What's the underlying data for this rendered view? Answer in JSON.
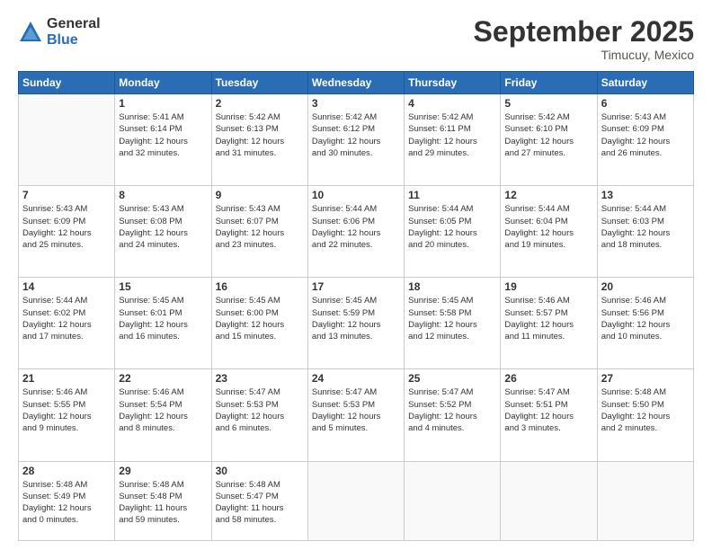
{
  "logo": {
    "general": "General",
    "blue": "Blue"
  },
  "header": {
    "month": "September 2025",
    "location": "Timucuy, Mexico"
  },
  "weekdays": [
    "Sunday",
    "Monday",
    "Tuesday",
    "Wednesday",
    "Thursday",
    "Friday",
    "Saturday"
  ],
  "weeks": [
    [
      {
        "day": "",
        "detail": ""
      },
      {
        "day": "1",
        "detail": "Sunrise: 5:41 AM\nSunset: 6:14 PM\nDaylight: 12 hours\nand 32 minutes."
      },
      {
        "day": "2",
        "detail": "Sunrise: 5:42 AM\nSunset: 6:13 PM\nDaylight: 12 hours\nand 31 minutes."
      },
      {
        "day": "3",
        "detail": "Sunrise: 5:42 AM\nSunset: 6:12 PM\nDaylight: 12 hours\nand 30 minutes."
      },
      {
        "day": "4",
        "detail": "Sunrise: 5:42 AM\nSunset: 6:11 PM\nDaylight: 12 hours\nand 29 minutes."
      },
      {
        "day": "5",
        "detail": "Sunrise: 5:42 AM\nSunset: 6:10 PM\nDaylight: 12 hours\nand 27 minutes."
      },
      {
        "day": "6",
        "detail": "Sunrise: 5:43 AM\nSunset: 6:09 PM\nDaylight: 12 hours\nand 26 minutes."
      }
    ],
    [
      {
        "day": "7",
        "detail": "Sunrise: 5:43 AM\nSunset: 6:09 PM\nDaylight: 12 hours\nand 25 minutes."
      },
      {
        "day": "8",
        "detail": "Sunrise: 5:43 AM\nSunset: 6:08 PM\nDaylight: 12 hours\nand 24 minutes."
      },
      {
        "day": "9",
        "detail": "Sunrise: 5:43 AM\nSunset: 6:07 PM\nDaylight: 12 hours\nand 23 minutes."
      },
      {
        "day": "10",
        "detail": "Sunrise: 5:44 AM\nSunset: 6:06 PM\nDaylight: 12 hours\nand 22 minutes."
      },
      {
        "day": "11",
        "detail": "Sunrise: 5:44 AM\nSunset: 6:05 PM\nDaylight: 12 hours\nand 20 minutes."
      },
      {
        "day": "12",
        "detail": "Sunrise: 5:44 AM\nSunset: 6:04 PM\nDaylight: 12 hours\nand 19 minutes."
      },
      {
        "day": "13",
        "detail": "Sunrise: 5:44 AM\nSunset: 6:03 PM\nDaylight: 12 hours\nand 18 minutes."
      }
    ],
    [
      {
        "day": "14",
        "detail": "Sunrise: 5:44 AM\nSunset: 6:02 PM\nDaylight: 12 hours\nand 17 minutes."
      },
      {
        "day": "15",
        "detail": "Sunrise: 5:45 AM\nSunset: 6:01 PM\nDaylight: 12 hours\nand 16 minutes."
      },
      {
        "day": "16",
        "detail": "Sunrise: 5:45 AM\nSunset: 6:00 PM\nDaylight: 12 hours\nand 15 minutes."
      },
      {
        "day": "17",
        "detail": "Sunrise: 5:45 AM\nSunset: 5:59 PM\nDaylight: 12 hours\nand 13 minutes."
      },
      {
        "day": "18",
        "detail": "Sunrise: 5:45 AM\nSunset: 5:58 PM\nDaylight: 12 hours\nand 12 minutes."
      },
      {
        "day": "19",
        "detail": "Sunrise: 5:46 AM\nSunset: 5:57 PM\nDaylight: 12 hours\nand 11 minutes."
      },
      {
        "day": "20",
        "detail": "Sunrise: 5:46 AM\nSunset: 5:56 PM\nDaylight: 12 hours\nand 10 minutes."
      }
    ],
    [
      {
        "day": "21",
        "detail": "Sunrise: 5:46 AM\nSunset: 5:55 PM\nDaylight: 12 hours\nand 9 minutes."
      },
      {
        "day": "22",
        "detail": "Sunrise: 5:46 AM\nSunset: 5:54 PM\nDaylight: 12 hours\nand 8 minutes."
      },
      {
        "day": "23",
        "detail": "Sunrise: 5:47 AM\nSunset: 5:53 PM\nDaylight: 12 hours\nand 6 minutes."
      },
      {
        "day": "24",
        "detail": "Sunrise: 5:47 AM\nSunset: 5:53 PM\nDaylight: 12 hours\nand 5 minutes."
      },
      {
        "day": "25",
        "detail": "Sunrise: 5:47 AM\nSunset: 5:52 PM\nDaylight: 12 hours\nand 4 minutes."
      },
      {
        "day": "26",
        "detail": "Sunrise: 5:47 AM\nSunset: 5:51 PM\nDaylight: 12 hours\nand 3 minutes."
      },
      {
        "day": "27",
        "detail": "Sunrise: 5:48 AM\nSunset: 5:50 PM\nDaylight: 12 hours\nand 2 minutes."
      }
    ],
    [
      {
        "day": "28",
        "detail": "Sunrise: 5:48 AM\nSunset: 5:49 PM\nDaylight: 12 hours\nand 0 minutes."
      },
      {
        "day": "29",
        "detail": "Sunrise: 5:48 AM\nSunset: 5:48 PM\nDaylight: 11 hours\nand 59 minutes."
      },
      {
        "day": "30",
        "detail": "Sunrise: 5:48 AM\nSunset: 5:47 PM\nDaylight: 11 hours\nand 58 minutes."
      },
      {
        "day": "",
        "detail": ""
      },
      {
        "day": "",
        "detail": ""
      },
      {
        "day": "",
        "detail": ""
      },
      {
        "day": "",
        "detail": ""
      }
    ]
  ]
}
